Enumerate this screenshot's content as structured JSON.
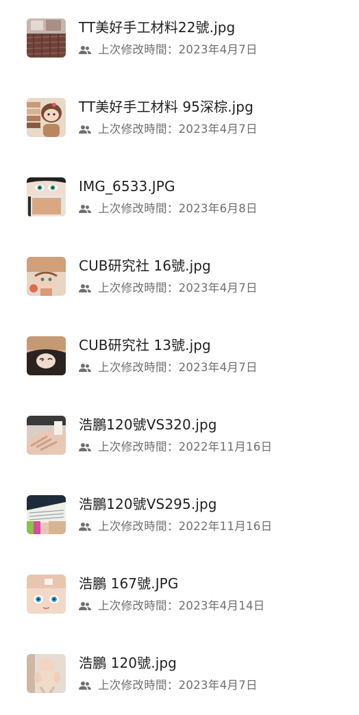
{
  "meta_label": "上次修改時間：",
  "icons": {
    "shared": "people-icon"
  },
  "files": [
    {
      "name": "TT美好手工材料22號.jpg",
      "modified": "2023年4月7日"
    },
    {
      "name": "TT美好手工材料 95深棕.jpg",
      "modified": "2023年4月7日"
    },
    {
      "name": "IMG_6533.JPG",
      "modified": "2023年6月8日"
    },
    {
      "name": "CUB研究社 16號.jpg",
      "modified": "2023年4月7日"
    },
    {
      "name": "CUB研究社 13號.jpg",
      "modified": "2023年4月7日"
    },
    {
      "name": "浩鵬120號VS320.jpg",
      "modified": "2022年11月16日"
    },
    {
      "name": "浩鵬120號VS295.jpg",
      "modified": "2022年11月16日"
    },
    {
      "name": "浩鵬 167號.JPG",
      "modified": "2023年4月14日"
    },
    {
      "name": "浩鵬 120號.jpg",
      "modified": "2023年4月7日"
    }
  ]
}
